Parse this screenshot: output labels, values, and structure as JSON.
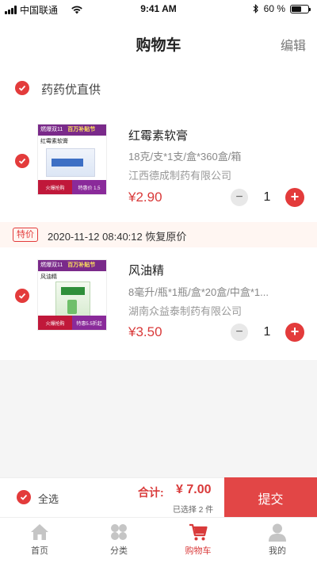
{
  "status_bar": {
    "carrier": "中国联通",
    "time": "9:41 AM",
    "battery": "60 %",
    "battery_level": 0.6
  },
  "nav": {
    "title": "购物车",
    "edit_label": "编辑"
  },
  "store": {
    "name": "药药优直供"
  },
  "items": [
    {
      "name": "红霉素软膏",
      "spec": "18克/支*1支/盒*360盒/箱",
      "company": "江西德成制药有限公司",
      "price": "¥2.90",
      "qty": "1",
      "thumb": {
        "banner": "燃爆双11",
        "banner_sub": "百万补贴节",
        "title": "红霉素软膏",
        "foot_left": "火爆抢购",
        "foot_right": "特惠价 1.5"
      }
    },
    {
      "name": "风油精",
      "spec": "8毫升/瓶*1瓶/盒*20盒/中盒*1...",
      "company": "湖南众益泰制药有限公司",
      "price": "¥3.50",
      "qty": "1",
      "thumb": {
        "banner": "燃爆双11",
        "banner_sub": "百万补贴节",
        "title": "风油精",
        "foot_left": "火爆抢购",
        "foot_right": "特惠5.5折起"
      }
    }
  ],
  "promo": {
    "badge": "特价",
    "text": "2020-11-12  08:40:12 恢复原价"
  },
  "stepper": {
    "minus": "−",
    "plus": "+"
  },
  "checkout": {
    "select_all": "全选",
    "total_label": "合计:",
    "total_value": "¥ 7.00",
    "selected_count": "已选择 2 件",
    "submit": "提交"
  },
  "tabs": [
    {
      "label": "首页",
      "icon": "home-icon"
    },
    {
      "label": "分类",
      "icon": "category-icon"
    },
    {
      "label": "购物车",
      "icon": "cart-icon"
    },
    {
      "label": "我的",
      "icon": "user-icon"
    }
  ],
  "colors": {
    "accent": "#e33b3b",
    "price": "#d93a3a",
    "tab_inactive": "#c5c5c5"
  }
}
